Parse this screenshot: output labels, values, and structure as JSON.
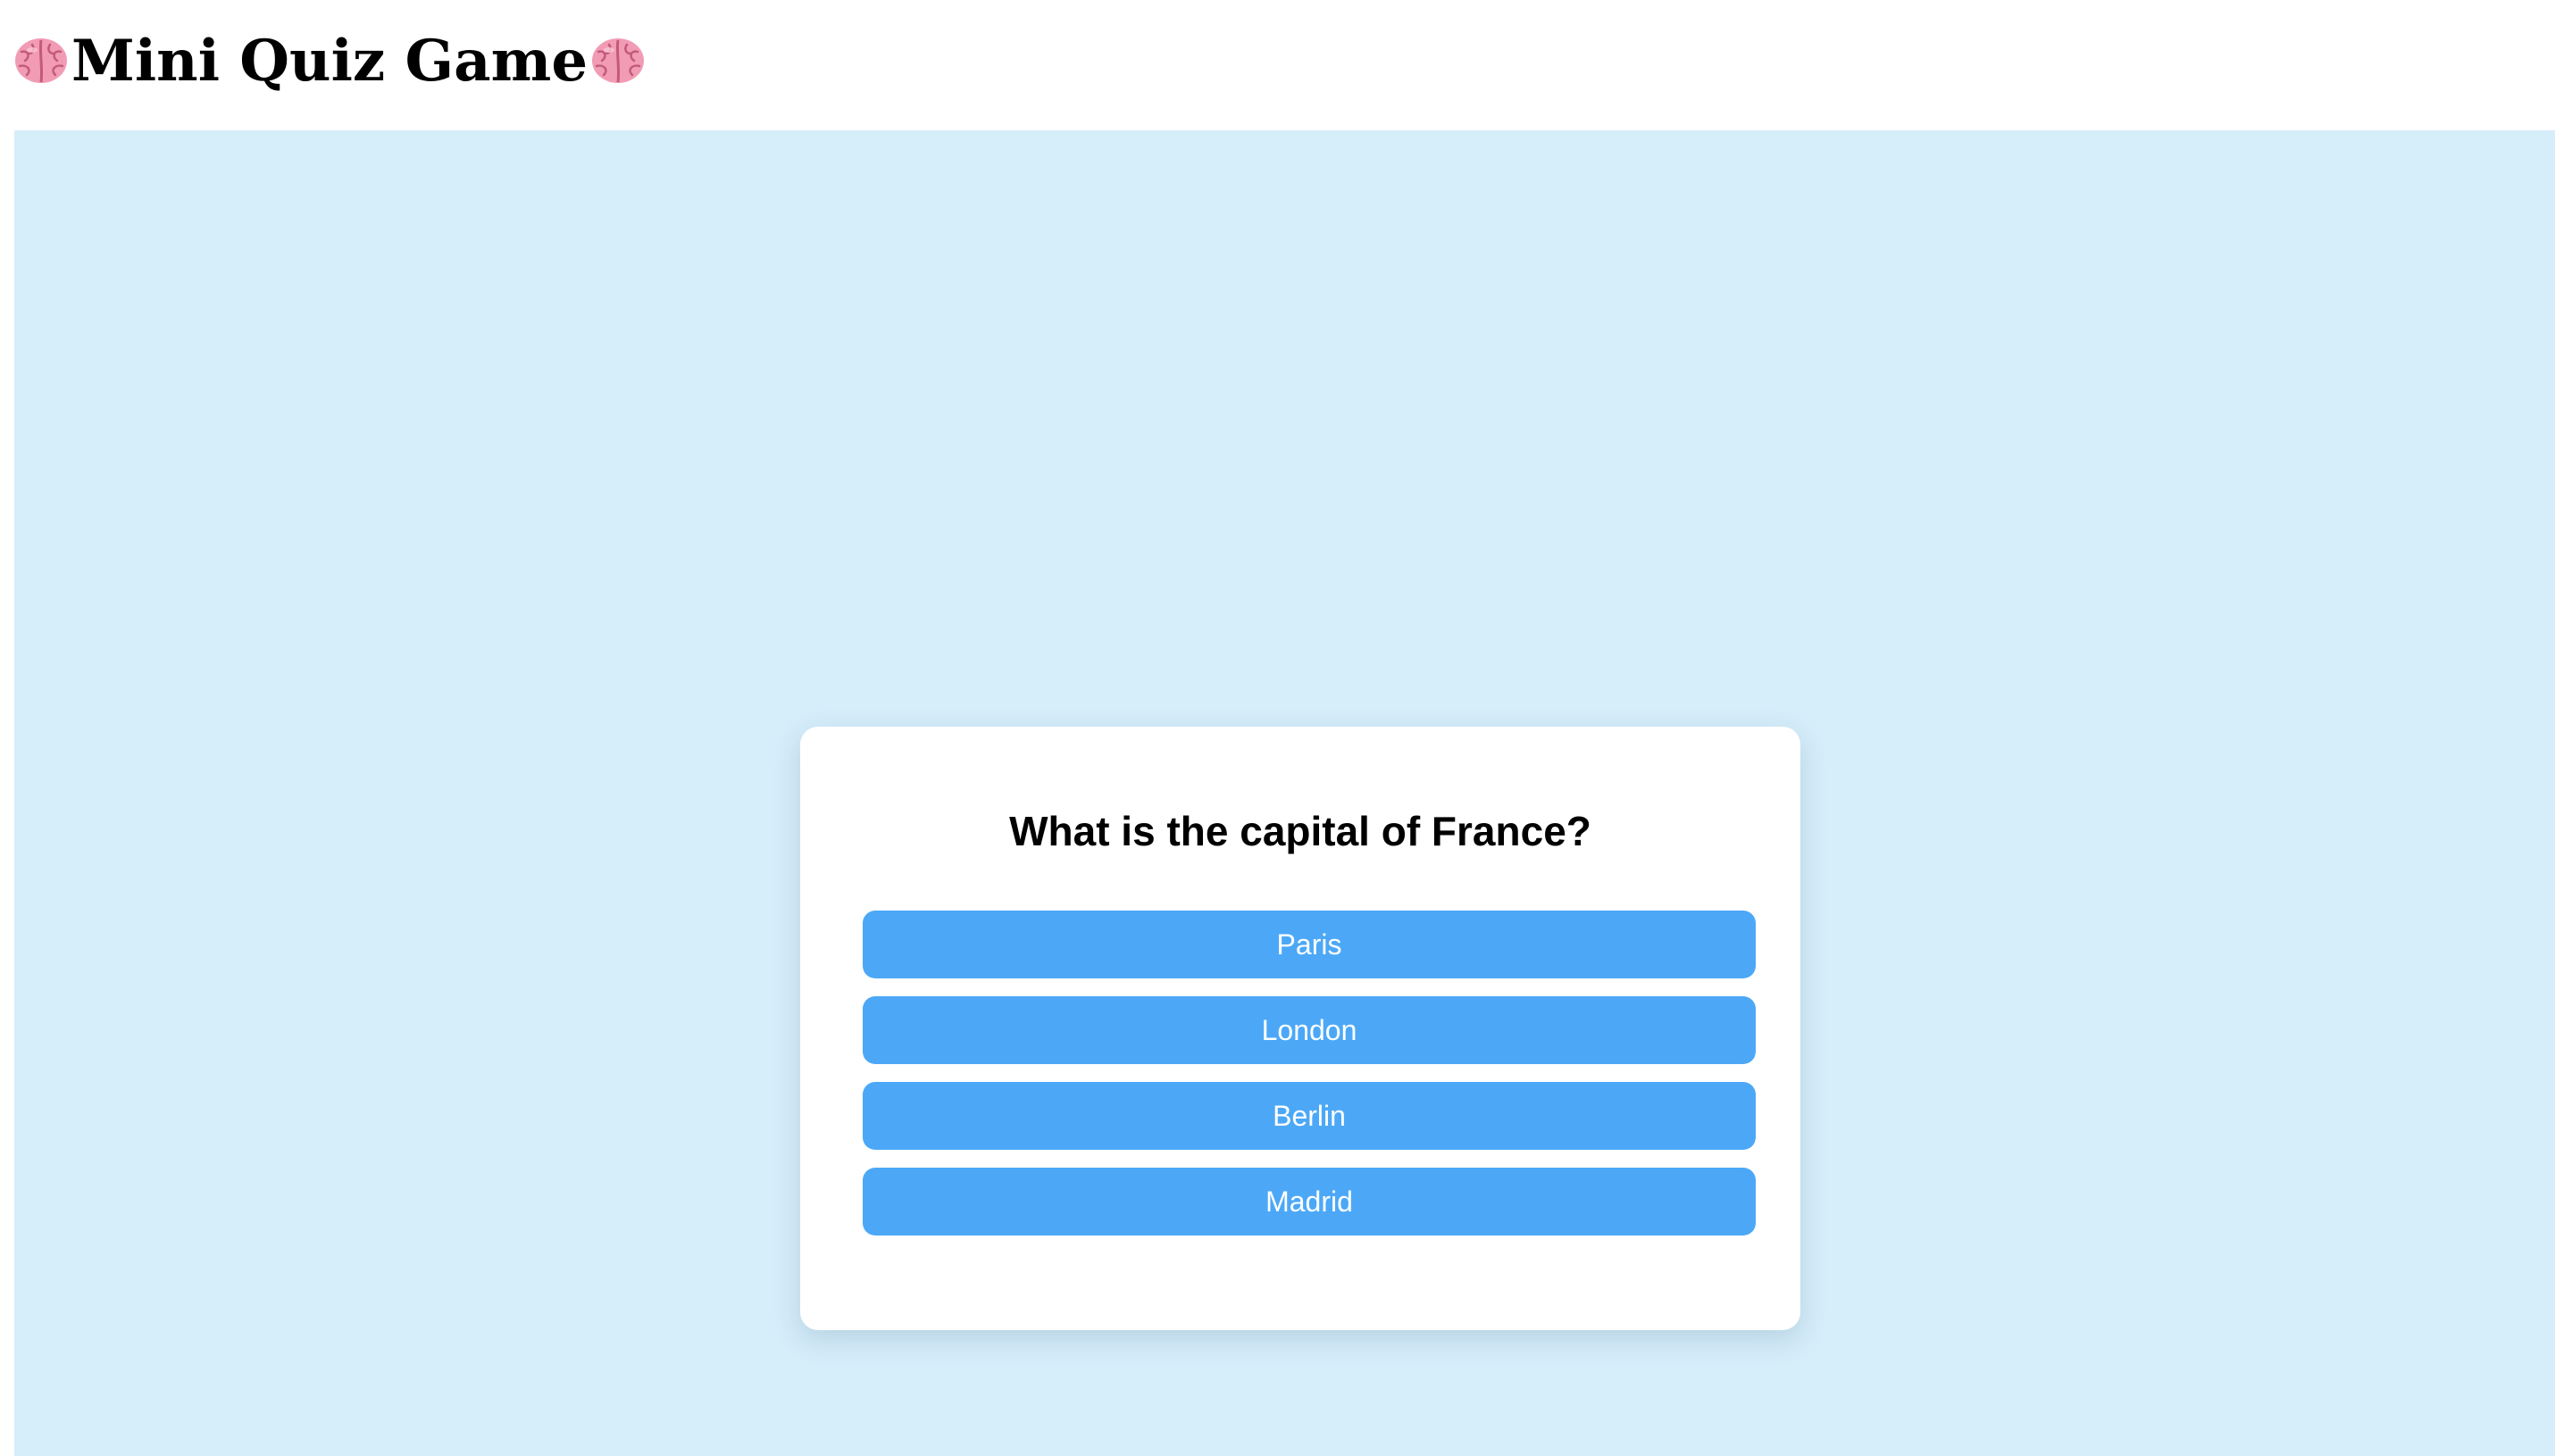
{
  "header": {
    "title": "Mini Quiz Game",
    "left_icon": "brain-icon",
    "right_icon": "brain-icon"
  },
  "quiz": {
    "question": "What is the capital of France?",
    "answers": [
      {
        "label": "Paris"
      },
      {
        "label": "London"
      },
      {
        "label": "Berlin"
      },
      {
        "label": "Madrid"
      }
    ]
  },
  "colors": {
    "stage_background": "#d6edfa",
    "card_background": "#ffffff",
    "button_background": "#4ca8f7",
    "button_text": "#ffffff"
  }
}
